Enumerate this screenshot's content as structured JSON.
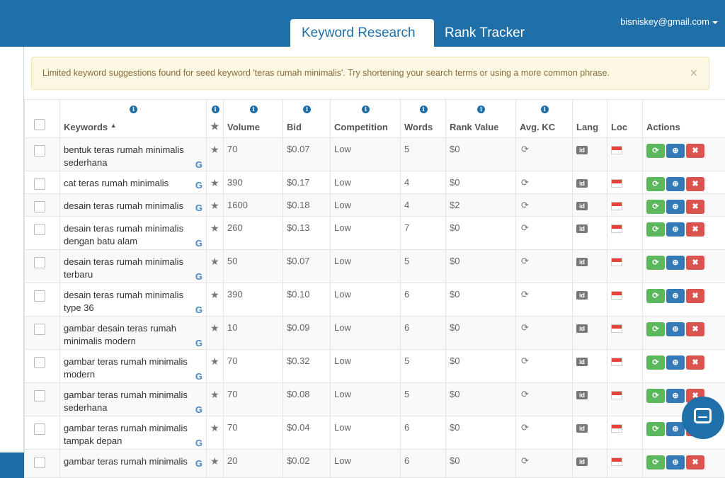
{
  "tabs": [
    {
      "label": "Keyword Research"
    },
    {
      "label": "Rank Tracker"
    }
  ],
  "user": {
    "email": "bisniskey@gmail.com"
  },
  "alert": {
    "text": "Limited keyword suggestions found for seed keyword 'teras rumah minimalis'. Try shortening your search terms or using a more common phrase.",
    "close": "×"
  },
  "table": {
    "headers": {
      "keywords": "Keywords",
      "volume": "Volume",
      "bid": "Bid",
      "competition": "Competition",
      "words": "Words",
      "rank_value": "Rank Value",
      "avg_kc": "Avg. KC",
      "lang": "Lang",
      "loc": "Loc",
      "actions": "Actions"
    },
    "rows": [
      {
        "keyword": "bentuk teras rumah minimalis sederhana",
        "volume": "70",
        "bid": "$0.07",
        "competition": "Low",
        "words": "5",
        "rank_value": "$0",
        "lang": "id"
      },
      {
        "keyword": "cat teras rumah minimalis",
        "volume": "390",
        "bid": "$0.17",
        "competition": "Low",
        "words": "4",
        "rank_value": "$0",
        "lang": "id"
      },
      {
        "keyword": "desain teras rumah minimalis",
        "volume": "1600",
        "bid": "$0.18",
        "competition": "Low",
        "words": "4",
        "rank_value": "$2",
        "lang": "id"
      },
      {
        "keyword": "desain teras rumah minimalis dengan batu alam",
        "volume": "260",
        "bid": "$0.13",
        "competition": "Low",
        "words": "7",
        "rank_value": "$0",
        "lang": "id"
      },
      {
        "keyword": "desain teras rumah minimalis terbaru",
        "volume": "50",
        "bid": "$0.07",
        "competition": "Low",
        "words": "5",
        "rank_value": "$0",
        "lang": "id"
      },
      {
        "keyword": "desain teras rumah minimalis type 36",
        "volume": "390",
        "bid": "$0.10",
        "competition": "Low",
        "words": "6",
        "rank_value": "$0",
        "lang": "id"
      },
      {
        "keyword": "gambar desain teras rumah minimalis modern",
        "volume": "10",
        "bid": "$0.09",
        "competition": "Low",
        "words": "6",
        "rank_value": "$0",
        "lang": "id"
      },
      {
        "keyword": "gambar teras rumah minimalis modern",
        "volume": "70",
        "bid": "$0.32",
        "competition": "Low",
        "words": "5",
        "rank_value": "$0",
        "lang": "id"
      },
      {
        "keyword": "gambar teras rumah minimalis sederhana",
        "volume": "70",
        "bid": "$0.08",
        "competition": "Low",
        "words": "5",
        "rank_value": "$0",
        "lang": "id"
      },
      {
        "keyword": "gambar teras rumah minimalis tampak depan",
        "volume": "70",
        "bid": "$0.04",
        "competition": "Low",
        "words": "6",
        "rank_value": "$0",
        "lang": "id"
      },
      {
        "keyword": "gambar teras rumah minimalis",
        "volume": "20",
        "bid": "$0.02",
        "competition": "Low",
        "words": "6",
        "rank_value": "$0",
        "lang": "id"
      }
    ]
  },
  "glyphs": {
    "info": "i",
    "sort": "▲",
    "star": "★",
    "google": "G",
    "refresh": "⟳",
    "rescan": "⟳",
    "search": "⊕",
    "remove": "✖"
  }
}
